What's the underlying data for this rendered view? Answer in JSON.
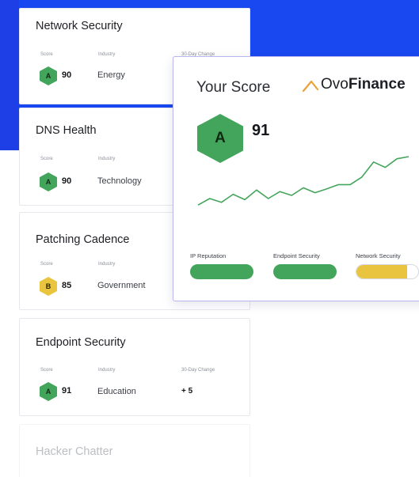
{
  "colors": {
    "background_band": "#1948f0",
    "grade_a": "#43a55b",
    "grade_b": "#e9c53f",
    "popup_border": "#b9b6ee"
  },
  "cards": [
    {
      "title": "Network Security",
      "score_label": "Score",
      "industry_label": "Industry",
      "change_label": "30-Day Change",
      "grade": "A",
      "score": "90",
      "industry": "Energy"
    },
    {
      "title": "DNS Health",
      "score_label": "Score",
      "industry_label": "Industry",
      "grade": "A",
      "score": "90",
      "industry": "Technology"
    },
    {
      "title": "Patching Cadence",
      "score_label": "Score",
      "industry_label": "Industry",
      "grade": "B",
      "score": "85",
      "industry": "Government"
    },
    {
      "title": "Endpoint Security",
      "score_label": "Score",
      "industry_label": "Industry",
      "change_label": "30-Day Change",
      "grade": "A",
      "score": "91",
      "industry": "Education",
      "change": "+ 5"
    },
    {
      "title": "Hacker Chatter"
    }
  ],
  "popup": {
    "your_score_label": "Your Score",
    "brand_prefix": "Ovo",
    "brand_bold": "Finance",
    "grade": "A",
    "score": "91",
    "trend": [
      0.1,
      0.22,
      0.15,
      0.3,
      0.2,
      0.38,
      0.22,
      0.35,
      0.28,
      0.42,
      0.33,
      0.4,
      0.48,
      0.48,
      0.62,
      0.9,
      0.8,
      0.96,
      1.0
    ],
    "metrics": [
      {
        "label": "IP Reputation",
        "level": 1.0,
        "color": "#43a55b"
      },
      {
        "label": "Endpoint Security",
        "level": 1.0,
        "color": "#43a55b"
      },
      {
        "label": "Network Security",
        "level": 0.82,
        "color": "#e9c53f"
      }
    ]
  }
}
